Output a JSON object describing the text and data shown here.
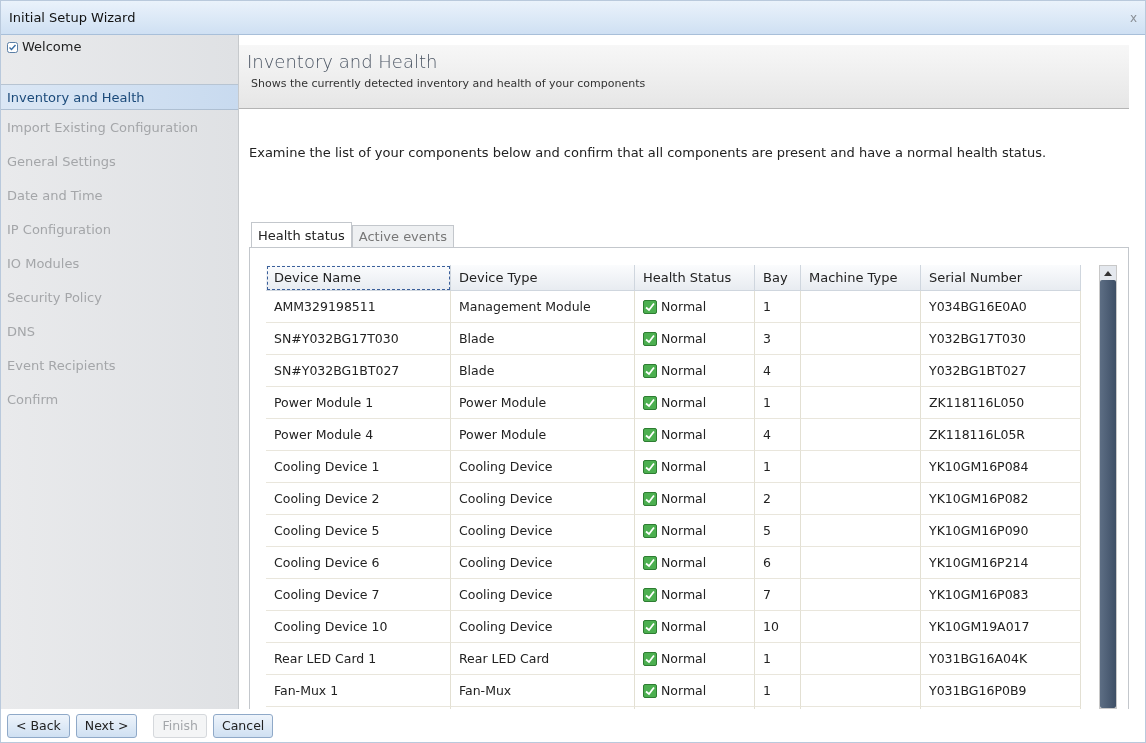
{
  "window": {
    "title": "Initial Setup Wizard",
    "close": "x"
  },
  "sidebar": {
    "items": [
      {
        "label": "Welcome",
        "checked": true,
        "selected": false,
        "disabled": false
      },
      {
        "label": "Inventory and Health",
        "checked": false,
        "selected": true,
        "disabled": false
      },
      {
        "label": "Import Existing Configuration",
        "checked": false,
        "selected": false,
        "disabled": true
      },
      {
        "label": "General Settings",
        "checked": false,
        "selected": false,
        "disabled": true
      },
      {
        "label": "Date and Time",
        "checked": false,
        "selected": false,
        "disabled": true
      },
      {
        "label": "IP Configuration",
        "checked": false,
        "selected": false,
        "disabled": true
      },
      {
        "label": "IO Modules",
        "checked": false,
        "selected": false,
        "disabled": true
      },
      {
        "label": "Security Policy",
        "checked": false,
        "selected": false,
        "disabled": true
      },
      {
        "label": "DNS",
        "checked": false,
        "selected": false,
        "disabled": true
      },
      {
        "label": "Event Recipients",
        "checked": false,
        "selected": false,
        "disabled": true
      },
      {
        "label": "Confirm",
        "checked": false,
        "selected": false,
        "disabled": true
      }
    ]
  },
  "header": {
    "title": "Inventory and Health",
    "subtitle": "Shows the currently detected inventory and health of your components"
  },
  "instructions": "Examine the list of your components below and confirm that all components are present and have a normal health status.",
  "tabs": [
    {
      "label": "Health status",
      "selected": true
    },
    {
      "label": "Active events",
      "selected": false
    }
  ],
  "table": {
    "columns": [
      "Device Name",
      "Device Type",
      "Health Status",
      "Bay",
      "Machine Type",
      "Serial Number"
    ],
    "rows": [
      [
        "AMM329198511",
        "Management Module",
        "Normal",
        "1",
        "",
        "Y034BG16E0A0"
      ],
      [
        "SN#Y032BG17T030",
        "Blade",
        "Normal",
        "3",
        "",
        "Y032BG17T030"
      ],
      [
        "SN#Y032BG1BT027",
        "Blade",
        "Normal",
        "4",
        "",
        "Y032BG1BT027"
      ],
      [
        "Power Module 1",
        "Power Module",
        "Normal",
        "1",
        "",
        "ZK118116L050"
      ],
      [
        "Power Module 4",
        "Power Module",
        "Normal",
        "4",
        "",
        "ZK118116L05R"
      ],
      [
        "Cooling Device 1",
        "Cooling Device",
        "Normal",
        "1",
        "",
        "YK10GM16P084"
      ],
      [
        "Cooling Device 2",
        "Cooling Device",
        "Normal",
        "2",
        "",
        "YK10GM16P082"
      ],
      [
        "Cooling Device 5",
        "Cooling Device",
        "Normal",
        "5",
        "",
        "YK10GM16P090"
      ],
      [
        "Cooling Device 6",
        "Cooling Device",
        "Normal",
        "6",
        "",
        "YK10GM16P214"
      ],
      [
        "Cooling Device 7",
        "Cooling Device",
        "Normal",
        "7",
        "",
        "YK10GM16P083"
      ],
      [
        "Cooling Device 10",
        "Cooling Device",
        "Normal",
        "10",
        "",
        "YK10GM19A017"
      ],
      [
        "Rear LED Card 1",
        "Rear LED Card",
        "Normal",
        "1",
        "",
        "Y031BG16A04K"
      ],
      [
        "Fan-Mux 1",
        "Fan-Mux",
        "Normal",
        "1",
        "",
        "Y031BG16P0B9"
      ]
    ]
  },
  "buttons": [
    {
      "label": "< Back",
      "disabled": false
    },
    {
      "label": "Next >",
      "disabled": false
    },
    {
      "label": "Finish",
      "disabled": true
    },
    {
      "label": "Cancel",
      "disabled": false
    }
  ]
}
